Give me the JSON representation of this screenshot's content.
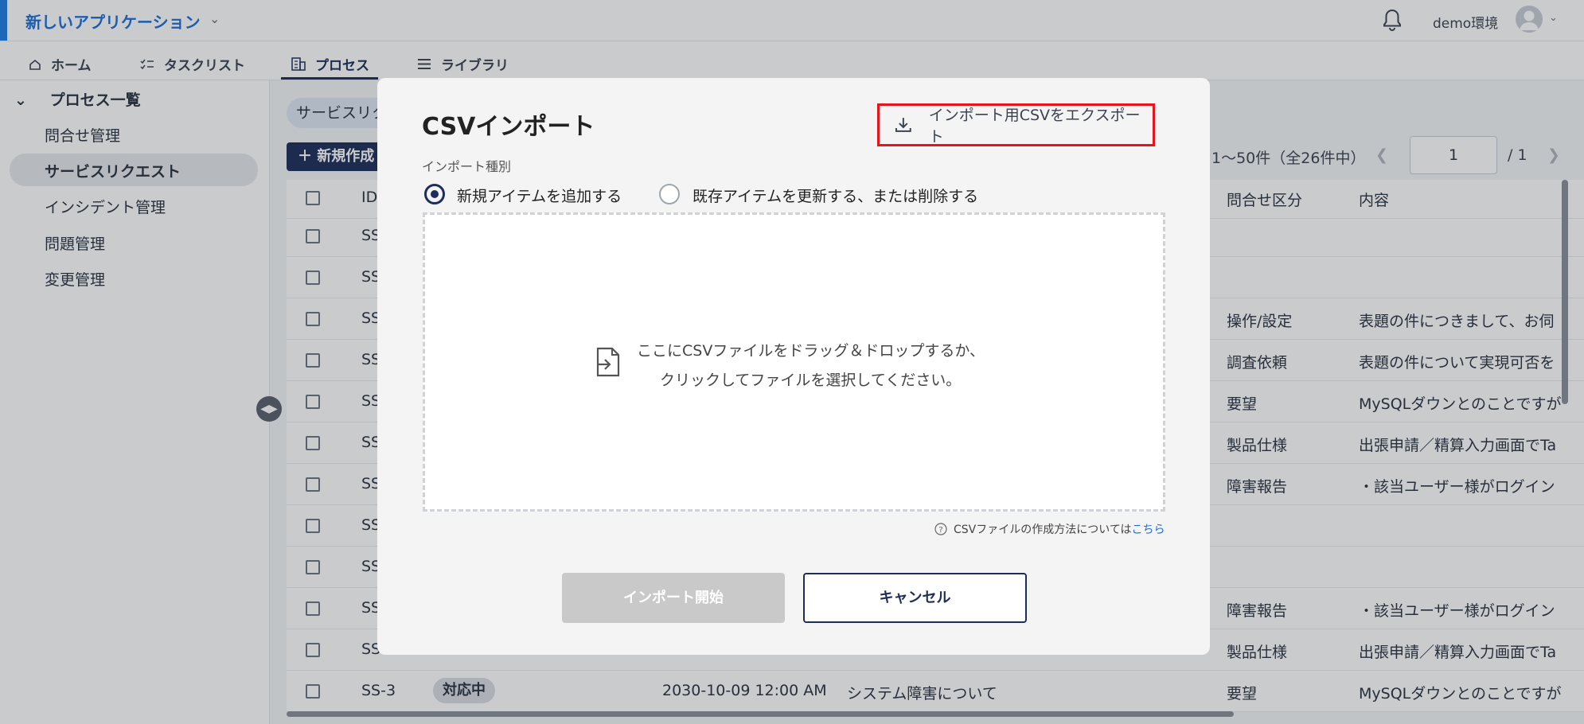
{
  "app": {
    "title": "新しいアプリケーション",
    "environment": "demo環境"
  },
  "nav": {
    "tabs": [
      {
        "label": "ホーム",
        "icon": "home-icon"
      },
      {
        "label": "タスクリスト",
        "icon": "checklist-icon"
      },
      {
        "label": "プロセス",
        "icon": "building-icon",
        "active": true
      },
      {
        "label": "ライブラリ",
        "icon": "list-icon"
      }
    ]
  },
  "sidebar": {
    "heading": "プロセス一覧",
    "items": [
      {
        "label": "問合せ管理"
      },
      {
        "label": "サービスリクエスト",
        "selected": true
      },
      {
        "label": "インシデント管理"
      },
      {
        "label": "問題管理"
      },
      {
        "label": "変更管理"
      }
    ]
  },
  "main": {
    "chip": "サービスリクエスト",
    "new_button": "新規作成",
    "pager": {
      "range": "1〜50件（全26件中）",
      "page": "1",
      "total": "/ 1"
    },
    "columns": {
      "id": "ID",
      "category": "問合せ区分",
      "content": "内容"
    },
    "rows": [
      {
        "id": "SS",
        "category": "",
        "content": ""
      },
      {
        "id": "SS",
        "category": "",
        "content": ""
      },
      {
        "id": "SS",
        "category": "操作/設定",
        "content": "表題の件につきまして、お伺"
      },
      {
        "id": "SS",
        "category": "調査依頼",
        "content": "表題の件について実現可否を"
      },
      {
        "id": "SS",
        "category": "要望",
        "content": "MySQLダウンとのことですが"
      },
      {
        "id": "SS",
        "category": "製品仕様",
        "content": "出張申請／精算入力画面でTa"
      },
      {
        "id": "SS",
        "category": "障害報告",
        "content": "・該当ユーザー様がログイン"
      },
      {
        "id": "SS",
        "category": "",
        "content": ""
      },
      {
        "id": "SS",
        "category": "",
        "content": ""
      },
      {
        "id": "SS",
        "category": "障害報告",
        "content": "・該当ユーザー様がログイン"
      },
      {
        "id": "SS-",
        "category": "製品仕様",
        "content": "出張申請／精算入力画面でTa"
      },
      {
        "id": "SS-3",
        "status": "対応中",
        "date": "2030-10-09 12:00 AM",
        "title": "システム障害について",
        "category": "要望",
        "content": "MySQLダウンとのことですが"
      }
    ]
  },
  "modal": {
    "title": "CSVインポート",
    "export_link": "インポート用CSVをエクスポート",
    "import_type_label": "インポート種別",
    "options": [
      {
        "label": "新規アイテムを追加する",
        "selected": true
      },
      {
        "label": "既存アイテムを更新する、または削除する",
        "selected": false
      }
    ],
    "drop_line1": "ここにCSVファイルをドラッグ＆ドロップするか、",
    "drop_line2": "クリックしてファイルを選択してください。",
    "help_text": "CSVファイルの作成方法については",
    "help_link": "こちら",
    "start_button": "インポート開始",
    "cancel_button": "キャンセル"
  },
  "colors": {
    "accent": "#1f7ee6",
    "navy": "#1e2d5a",
    "highlight": "#e8141b"
  }
}
